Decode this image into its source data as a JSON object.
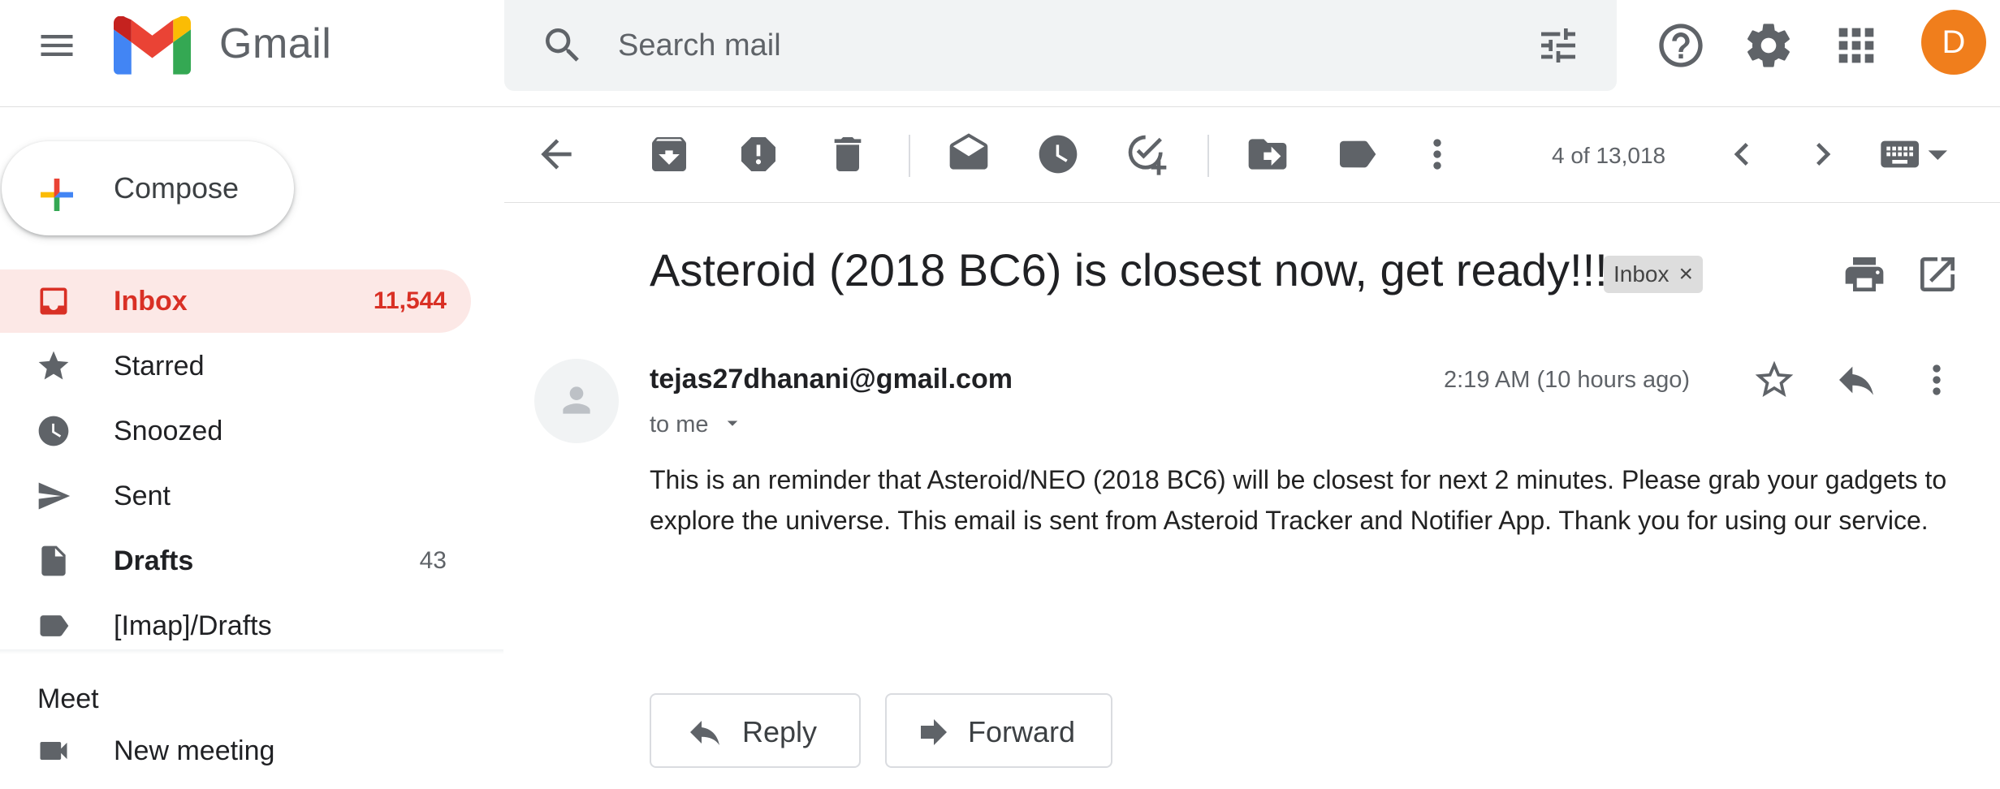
{
  "app": {
    "name": "Gmail"
  },
  "search": {
    "placeholder": "Search mail"
  },
  "account": {
    "initial": "D",
    "color": "#f07e1c"
  },
  "sidebar": {
    "compose_label": "Compose",
    "items": [
      {
        "label": "Inbox",
        "count": "11,544",
        "icon": "inbox-icon",
        "active": true
      },
      {
        "label": "Starred",
        "count": "",
        "icon": "star-icon"
      },
      {
        "label": "Snoozed",
        "count": "",
        "icon": "clock-icon"
      },
      {
        "label": "Sent",
        "count": "",
        "icon": "send-icon"
      },
      {
        "label": "Drafts",
        "count": "43",
        "icon": "draft-icon"
      },
      {
        "label": "[Imap]/Drafts",
        "count": "",
        "icon": "label-icon"
      }
    ],
    "meet": {
      "title": "Meet",
      "new_meeting": "New meeting"
    }
  },
  "toolbar": {
    "pager": "4 of 13,018"
  },
  "email": {
    "subject": "Asteroid (2018 BC6) is closest now, get ready!!!",
    "label_chip": "Inbox",
    "from": "tejas27dhanani@gmail.com",
    "to": "to me",
    "time": "2:19 AM (10 hours ago)",
    "body": "This is an reminder that Asteroid/NEO (2018 BC6) will be closest for next 2 minutes. Please grab your gadgets to explore the universe. This email is sent from Asteroid Tracker and Notifier App. Thank you for using our service.",
    "reply_label": "Reply",
    "forward_label": "Forward"
  },
  "colors": {
    "accent": "#d93025",
    "active_bg": "#fce8e6",
    "icon": "#5f6368"
  }
}
